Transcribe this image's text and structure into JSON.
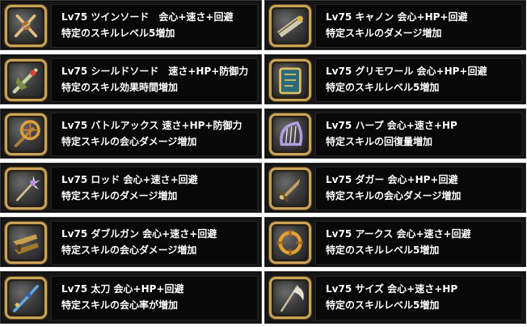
{
  "items": [
    {
      "title": "Lv75 ツインソード　会心+速さ+回避",
      "effect": "特定のスキルレベル5増加",
      "icon": "twin-sword-icon"
    },
    {
      "title": "Lv75 シールドソード　速さ+HP+防御力",
      "effect": "特定のスキル効果時間増加",
      "icon": "shield-sword-icon"
    },
    {
      "title": "Lv75 バトルアックス 速さ+HP+防御力",
      "effect": "特定スキルの会心ダメージ増加",
      "icon": "battle-axe-icon"
    },
    {
      "title": "Lv75 ロッド 会心+速さ+回避",
      "effect": "特定スキルのダメージ増加",
      "icon": "rod-icon"
    },
    {
      "title": "Lv75 ダブルガン 会心+速さ+回避",
      "effect": "特定スキルの会心ダメージ増加",
      "icon": "double-gun-icon"
    },
    {
      "title": "Lv75 太刀 会心+HP+回避",
      "effect": "特定スキルの会心率が増加",
      "icon": "katana-icon"
    },
    {
      "title": "Lv75 キャノン 会心+HP+回避",
      "effect": "特定スキルのダメージ増加",
      "icon": "cannon-icon"
    },
    {
      "title": "Lv75 グリモワール 会心+HP+回避",
      "effect": "特定のスキルレベル5増加",
      "icon": "grimoire-icon"
    },
    {
      "title": "Lv75 ハープ 会心+速さ+HP",
      "effect": "特定スキルの回復量増加",
      "icon": "harp-icon"
    },
    {
      "title": "Lv75 ダガー 会心+HP+回避",
      "effect": "特定スキルの会心ダメージ増加",
      "icon": "dagger-icon"
    },
    {
      "title": "Lv75 アークス 会心+速さ+回避",
      "effect": "特定のスキルレベル5増加",
      "icon": "arcs-icon"
    },
    {
      "title": "Lv75 サイズ 会心+速さ+HP",
      "effect": "特定のスキルレベル5増加",
      "icon": "scythe-icon"
    }
  ]
}
